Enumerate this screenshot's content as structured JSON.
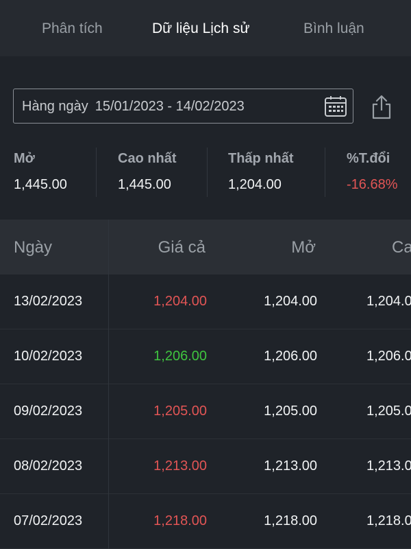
{
  "tabs": [
    {
      "label": "Phân tích",
      "active": false
    },
    {
      "label": "Dữ liệu Lịch sử",
      "active": true
    },
    {
      "label": "Bình luận",
      "active": false
    }
  ],
  "date_filter": {
    "period": "Hàng ngày",
    "range": "15/01/2023 - 14/02/2023",
    "calendar_icon": "calendar-icon",
    "share_icon": "share-icon"
  },
  "stats": [
    {
      "label": "Mở",
      "value": "1,445.00"
    },
    {
      "label": "Cao nhất",
      "value": "1,445.00"
    },
    {
      "label": "Thấp nhất",
      "value": "1,204.00"
    },
    {
      "label": "%T.đổi",
      "value": "-16.68%"
    }
  ],
  "table": {
    "headers": [
      "Ngày",
      "Giá cả",
      "Mở",
      "Ca"
    ],
    "rows": [
      {
        "date": "13/02/2023",
        "price": "1,204.00",
        "direction": "down",
        "open": "1,204.00",
        "high": "1,204.0"
      },
      {
        "date": "10/02/2023",
        "price": "1,206.00",
        "direction": "up",
        "open": "1,206.00",
        "high": "1,206.0"
      },
      {
        "date": "09/02/2023",
        "price": "1,205.00",
        "direction": "down",
        "open": "1,205.00",
        "high": "1,205.0"
      },
      {
        "date": "08/02/2023",
        "price": "1,213.00",
        "direction": "down",
        "open": "1,213.00",
        "high": "1,213.0"
      },
      {
        "date": "07/02/2023",
        "price": "1,218.00",
        "direction": "down",
        "open": "1,218.00",
        "high": "1,218.0"
      }
    ]
  },
  "colors": {
    "negative": "#e25555",
    "positive": "#3fc43f",
    "background": "#1f2329"
  }
}
